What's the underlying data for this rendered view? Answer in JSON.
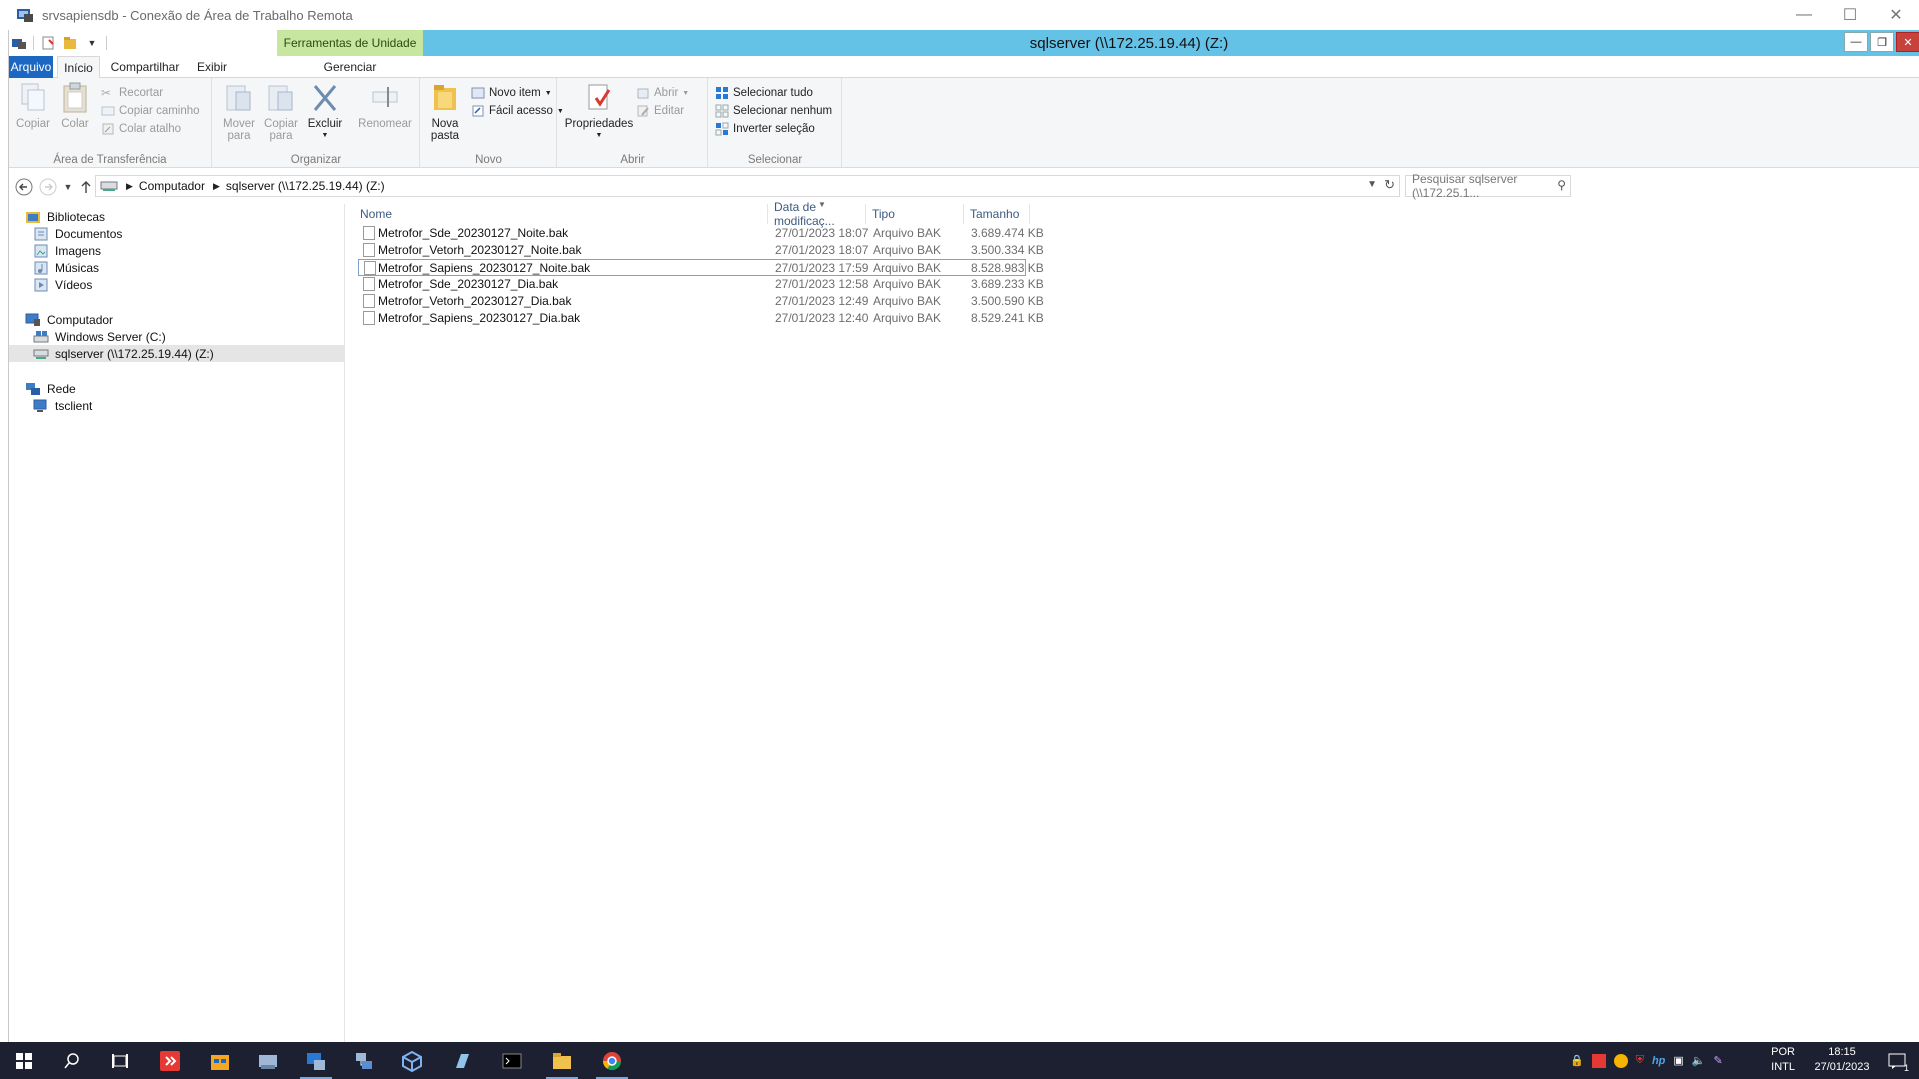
{
  "rdp": {
    "title": "srvsapiensdb - Conexão de Área de Trabalho Remota"
  },
  "window": {
    "title": "sqlserver (\\\\172.25.19.44) (Z:)",
    "context_tab": "Ferramentas de Unidade"
  },
  "tabs": {
    "file": "Arquivo",
    "home": "Início",
    "share": "Compartilhar",
    "view": "Exibir",
    "manage": "Gerenciar"
  },
  "ribbon": {
    "clipboard": {
      "label": "Área de Transferência",
      "copy": "Copiar",
      "paste": "Colar",
      "cut": "Recortar",
      "copy_path": "Copiar caminho",
      "paste_shortcut": "Colar atalho"
    },
    "organize": {
      "label": "Organizar",
      "move_to": "Mover\npara",
      "copy_to": "Copiar\npara",
      "delete": "Excluir",
      "rename": "Renomear"
    },
    "new": {
      "label": "Novo",
      "new_folder": "Nova\npasta",
      "new_item": "Novo item",
      "easy_access": "Fácil acesso"
    },
    "open": {
      "label": "Abrir",
      "properties": "Propriedades",
      "open": "Abrir",
      "edit": "Editar"
    },
    "select": {
      "label": "Selecionar",
      "select_all": "Selecionar tudo",
      "select_none": "Selecionar nenhum",
      "invert": "Inverter seleção"
    }
  },
  "address": {
    "crumbs": [
      "Computador",
      "sqlserver (\\\\172.25.19.44) (Z:)"
    ]
  },
  "search": {
    "placeholder": "Pesquisar sqlserver (\\\\172.25.1..."
  },
  "nav": {
    "libraries": "Bibliotecas",
    "documents": "Documentos",
    "images": "Imagens",
    "music": "Músicas",
    "videos": "Vídeos",
    "computer": "Computador",
    "drive_c": "Windows Server (C:)",
    "drive_z": "sqlserver (\\\\172.25.19.44) (Z:)",
    "network": "Rede",
    "tsclient": "tsclient"
  },
  "columns": {
    "name": "Nome",
    "date": "Data de modificaç...",
    "type": "Tipo",
    "size": "Tamanho"
  },
  "files": [
    {
      "name": "Metrofor_Sde_20230127_Noite.bak",
      "date": "27/01/2023 18:07",
      "type": "Arquivo BAK",
      "size": "3.689.474 KB"
    },
    {
      "name": "Metrofor_Vetorh_20230127_Noite.bak",
      "date": "27/01/2023 18:07",
      "type": "Arquivo BAK",
      "size": "3.500.334 KB"
    },
    {
      "name": "Metrofor_Sapiens_20230127_Noite.bak",
      "date": "27/01/2023 17:59",
      "type": "Arquivo BAK",
      "size": "8.528.983 KB"
    },
    {
      "name": "Metrofor_Sde_20230127_Dia.bak",
      "date": "27/01/2023 12:58",
      "type": "Arquivo BAK",
      "size": "3.689.233 KB"
    },
    {
      "name": "Metrofor_Vetorh_20230127_Dia.bak",
      "date": "27/01/2023 12:49",
      "type": "Arquivo BAK",
      "size": "3.500.590 KB"
    },
    {
      "name": "Metrofor_Sapiens_20230127_Dia.bak",
      "date": "27/01/2023 12:40",
      "type": "Arquivo BAK",
      "size": "8.529.241 KB"
    }
  ],
  "taskbar": {
    "lang1": "POR",
    "lang2": "INTL",
    "time": "18:15",
    "date": "27/01/2023",
    "notifications": "1"
  },
  "colors": {
    "accent": "#1c67c1",
    "title_bar": "#63c2e6",
    "context_tab": "#c7e7a1",
    "taskbar": "#1c2030"
  }
}
